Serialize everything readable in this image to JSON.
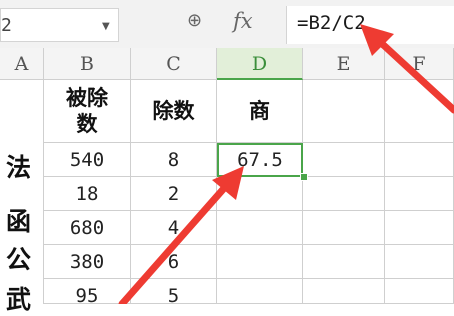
{
  "formula_bar": {
    "name_box_value": "2",
    "zoom_icon": "magnifier-icon",
    "fx_label": "fx",
    "formula": "=B2/C2"
  },
  "columns": [
    "A",
    "B",
    "C",
    "D",
    "E",
    "F"
  ],
  "row_label_chars": [
    "法",
    "函",
    "公",
    "武"
  ],
  "table": {
    "headers": [
      "被除\n数",
      "除数",
      "商"
    ],
    "rows": [
      [
        "540",
        "8",
        "67.5"
      ],
      [
        "18",
        "2",
        ""
      ],
      [
        "680",
        "4",
        ""
      ],
      [
        "380",
        "6",
        ""
      ],
      [
        "95",
        "5",
        ""
      ]
    ]
  },
  "colors": {
    "accent": "#4aa54a",
    "arrow": "#ee3b32"
  }
}
